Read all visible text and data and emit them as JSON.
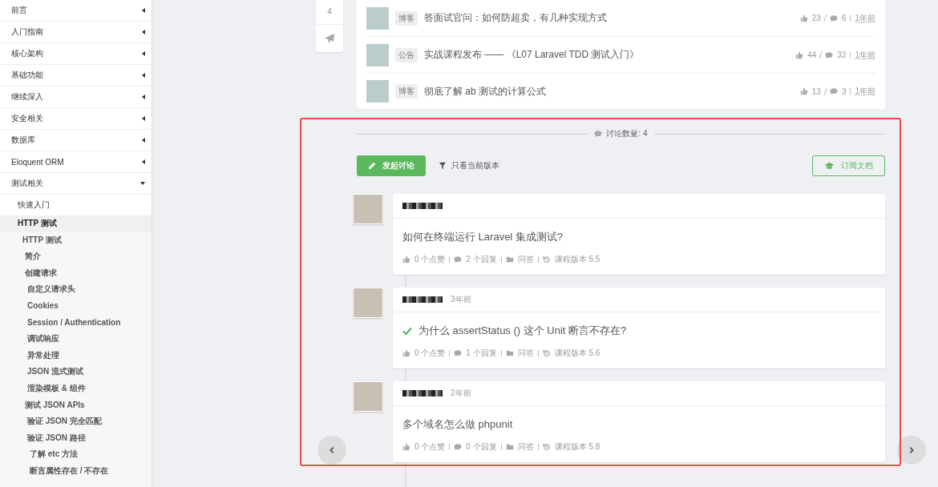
{
  "sidebar": {
    "items": [
      {
        "label": "前言",
        "expanded": false
      },
      {
        "label": "入门指南",
        "expanded": false
      },
      {
        "label": "核心架构",
        "expanded": false
      },
      {
        "label": "基础功能",
        "expanded": false
      },
      {
        "label": "继续深入",
        "expanded": false
      },
      {
        "label": "安全相关",
        "expanded": false
      },
      {
        "label": "数据库",
        "expanded": false
      },
      {
        "label": "Eloquent ORM",
        "expanded": false
      },
      {
        "label": "测试相关",
        "expanded": true,
        "children": [
          {
            "label": "快速入门",
            "selected": false
          },
          {
            "label": "HTTP 测试",
            "selected": true,
            "children": [
              {
                "label": "HTTP 测试",
                "selected": false,
                "children": [
                  {
                    "label": "简介",
                    "selected": false
                  },
                  {
                    "label": "创建请求",
                    "selected": false,
                    "children": [
                      {
                        "label": "自定义请求头",
                        "selected": false
                      },
                      {
                        "label": "Cookies",
                        "selected": false
                      },
                      {
                        "label": "Session / Authentication",
                        "selected": false
                      },
                      {
                        "label": "调试响应",
                        "selected": false
                      },
                      {
                        "label": "异常处理",
                        "selected": false
                      },
                      {
                        "label": "JSON 流式测试",
                        "selected": false
                      },
                      {
                        "label": "渲染模板 & 组件",
                        "selected": false
                      }
                    ]
                  },
                  {
                    "label": "测试 JSON APIs",
                    "selected": false,
                    "children": [
                      {
                        "label": "验证 JSON 完全匹配",
                        "selected": false
                      },
                      {
                        "label": "验证 JSON 路径",
                        "selected": false,
                        "children": [
                          {
                            "label": "了解 etc 方法",
                            "selected": false
                          },
                          {
                            "label": "断言属性存在 / 不存在",
                            "selected": false
                          }
                        ]
                      }
                    ]
                  }
                ]
              }
            ]
          }
        ]
      }
    ]
  },
  "side_tools": {
    "count": "4"
  },
  "articles": [
    {
      "tag": "博客",
      "title": "答面试官问：如何防超卖，有几种实现方式",
      "likes": "23",
      "comments": "6",
      "time": "1年前"
    },
    {
      "tag": "公告",
      "title": "实战课程发布 —— 《L07 Laravel TDD 测试入门》",
      "likes": "44",
      "comments": "33",
      "time": "1年前"
    },
    {
      "tag": "博客",
      "title": "彻底了解 ab 测试的计算公式",
      "likes": "13",
      "comments": "3",
      "time": "1年前"
    }
  ],
  "discussion": {
    "count_label": "讨论数量: 4",
    "new_button": "发起讨论",
    "filter": "只看当前版本",
    "subscribe_button": "订阅文档",
    "posts": [
      {
        "title": "如何在终端运行 Laravel 集成测试?",
        "solved": false,
        "likes": "0 个点赞",
        "replies": "2 个回复",
        "category": "问答",
        "version": "课程版本 5.5"
      },
      {
        "time": "3年前",
        "title": "为什么 assertStatus () 这个 Unit 断言不存在?",
        "solved": true,
        "likes": "0 个点赞",
        "replies": "1 个回复",
        "category": "问答",
        "version": "课程版本 5.6"
      },
      {
        "time": "2年前",
        "title": "多个域名怎么做 phpunit",
        "solved": false,
        "likes": "0 个点赞",
        "replies": "0 个回复",
        "category": "问答",
        "version": "课程版本 5.8"
      }
    ]
  }
}
